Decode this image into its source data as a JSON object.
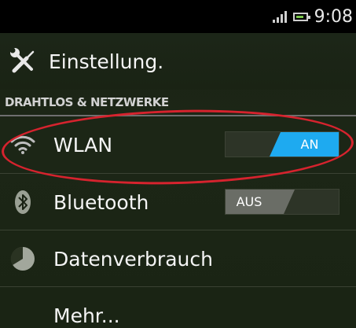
{
  "status_bar": {
    "time": "9:08",
    "icons": [
      "signal-icon",
      "battery-icon"
    ]
  },
  "action_bar": {
    "icon": "wrench-screwdriver-icon",
    "title": "Einstellung."
  },
  "section": {
    "title": "DRAHTLOS & NETZWERKE"
  },
  "items": [
    {
      "icon": "wifi-icon",
      "label": "WLAN",
      "toggle": {
        "state": "on",
        "label": "AN"
      }
    },
    {
      "icon": "bluetooth-icon",
      "label": "Bluetooth",
      "toggle": {
        "state": "off",
        "label": "AUS"
      }
    },
    {
      "icon": "data-usage-icon",
      "label": "Datenverbrauch"
    },
    {
      "icon": "",
      "label": "Mehr..."
    }
  ],
  "colors": {
    "toggle_on": "#1eaaf0",
    "toggle_off": "#6a6d66",
    "highlight": "#d6232e",
    "background": "#1a2314"
  }
}
